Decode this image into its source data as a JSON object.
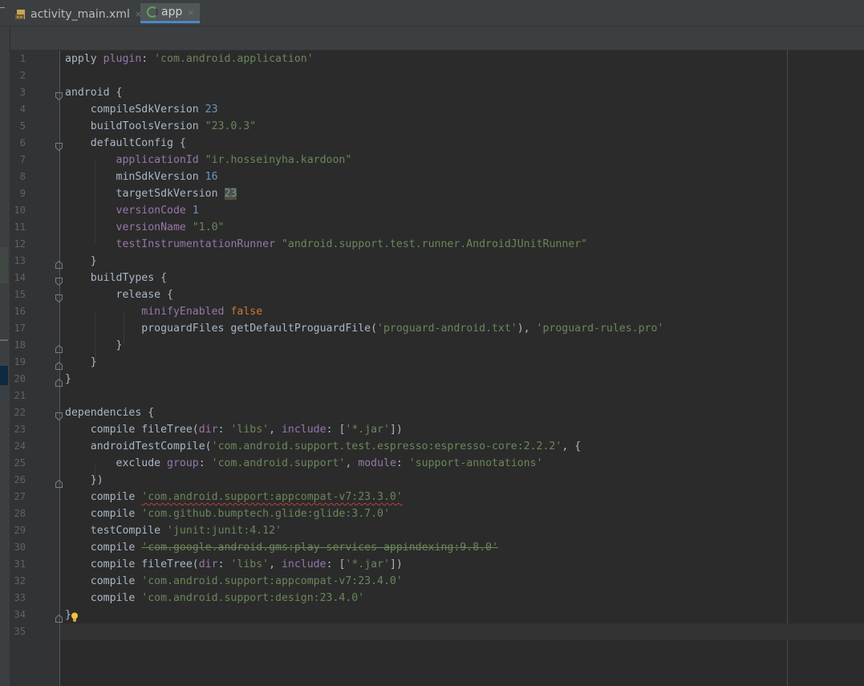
{
  "tabs": [
    {
      "label": "activity_main.xml",
      "icon": "xml-file-icon",
      "close": "×",
      "active": false
    },
    {
      "label": "app",
      "icon": "gradle-app-icon",
      "close": "×",
      "active": true
    }
  ],
  "editor": {
    "lines": [
      {
        "num": "1",
        "tokens": [
          [
            "plain",
            "apply "
          ],
          [
            "p",
            "plugin"
          ],
          [
            "plain",
            ": "
          ],
          [
            "s",
            "'com.android.application'"
          ]
        ]
      },
      {
        "num": "2",
        "tokens": []
      },
      {
        "num": "3",
        "tokens": [
          [
            "plain",
            "android {"
          ]
        ]
      },
      {
        "num": "4",
        "tokens": [
          [
            "plain",
            "    compileSdkVersion "
          ],
          [
            "n",
            "23"
          ]
        ]
      },
      {
        "num": "5",
        "tokens": [
          [
            "plain",
            "    buildToolsVersion "
          ],
          [
            "s",
            "\"23.0.3\""
          ]
        ]
      },
      {
        "num": "6",
        "tokens": [
          [
            "plain",
            "    defaultConfig {"
          ]
        ]
      },
      {
        "num": "7",
        "tokens": [
          [
            "plain",
            "        "
          ],
          [
            "p",
            "applicationId"
          ],
          [
            "plain",
            " "
          ],
          [
            "s",
            "\"ir.hosseinyha.kardoon\""
          ]
        ]
      },
      {
        "num": "8",
        "tokens": [
          [
            "plain",
            "        minSdkVersion "
          ],
          [
            "n",
            "16"
          ]
        ]
      },
      {
        "num": "9",
        "tokens": [
          [
            "plain",
            "        targetSdkVersion "
          ],
          [
            "nh",
            "23"
          ]
        ]
      },
      {
        "num": "10",
        "tokens": [
          [
            "plain",
            "        "
          ],
          [
            "p",
            "versionCode"
          ],
          [
            "plain",
            " "
          ],
          [
            "n",
            "1"
          ]
        ]
      },
      {
        "num": "11",
        "tokens": [
          [
            "plain",
            "        "
          ],
          [
            "p",
            "versionName"
          ],
          [
            "plain",
            " "
          ],
          [
            "s",
            "\"1.0\""
          ]
        ]
      },
      {
        "num": "12",
        "tokens": [
          [
            "plain",
            "        "
          ],
          [
            "p",
            "testInstrumentationRunner"
          ],
          [
            "plain",
            " "
          ],
          [
            "s",
            "\"android.support.test.runner.AndroidJUnitRunner\""
          ]
        ]
      },
      {
        "num": "13",
        "tokens": [
          [
            "plain",
            "    }"
          ]
        ]
      },
      {
        "num": "14",
        "tokens": [
          [
            "plain",
            "    buildTypes {"
          ]
        ]
      },
      {
        "num": "15",
        "tokens": [
          [
            "plain",
            "        release {"
          ]
        ]
      },
      {
        "num": "16",
        "tokens": [
          [
            "plain",
            "            "
          ],
          [
            "p",
            "minifyEnabled"
          ],
          [
            "plain",
            " "
          ],
          [
            "k",
            "false"
          ]
        ]
      },
      {
        "num": "17",
        "tokens": [
          [
            "plain",
            "            proguardFiles getDefaultProguardFile("
          ],
          [
            "s",
            "'proguard-android.txt'"
          ],
          [
            "plain",
            "), "
          ],
          [
            "s",
            "'proguard-rules.pro'"
          ]
        ]
      },
      {
        "num": "18",
        "tokens": [
          [
            "plain",
            "        }"
          ]
        ]
      },
      {
        "num": "19",
        "tokens": [
          [
            "plain",
            "    }"
          ]
        ]
      },
      {
        "num": "20",
        "tokens": [
          [
            "plain",
            "}"
          ]
        ]
      },
      {
        "num": "21",
        "tokens": []
      },
      {
        "num": "22",
        "tokens": [
          [
            "plain",
            "dependencies {"
          ]
        ]
      },
      {
        "num": "23",
        "tokens": [
          [
            "plain",
            "    compile fileTree("
          ],
          [
            "p",
            "dir"
          ],
          [
            "plain",
            ": "
          ],
          [
            "s",
            "'libs'"
          ],
          [
            "plain",
            ", "
          ],
          [
            "p",
            "include"
          ],
          [
            "plain",
            ": ["
          ],
          [
            "s",
            "'*.jar'"
          ],
          [
            "plain",
            "])"
          ]
        ]
      },
      {
        "num": "24",
        "tokens": [
          [
            "plain",
            "    androidTestCompile("
          ],
          [
            "s",
            "'com.android.support.test.espresso:espresso-core:2.2.2'"
          ],
          [
            "plain",
            ", {"
          ]
        ]
      },
      {
        "num": "25",
        "tokens": [
          [
            "plain",
            "        exclude "
          ],
          [
            "p",
            "group"
          ],
          [
            "plain",
            ": "
          ],
          [
            "s",
            "'com.android.support'"
          ],
          [
            "plain",
            ", "
          ],
          [
            "p",
            "module"
          ],
          [
            "plain",
            ": "
          ],
          [
            "s",
            "'support-annotations'"
          ]
        ]
      },
      {
        "num": "26",
        "tokens": [
          [
            "plain",
            "    })"
          ]
        ]
      },
      {
        "num": "27",
        "tokens": [
          [
            "plain",
            "    compile "
          ],
          [
            "ssq",
            "'com.android.support:appcompat-v7:23.3.0'"
          ]
        ]
      },
      {
        "num": "28",
        "tokens": [
          [
            "plain",
            "    compile "
          ],
          [
            "s",
            "'com.github.bumptech.glide:glide:3.7.0'"
          ]
        ]
      },
      {
        "num": "29",
        "tokens": [
          [
            "plain",
            "    testCompile "
          ],
          [
            "s",
            "'junit:junit:4.12'"
          ]
        ]
      },
      {
        "num": "30",
        "tokens": [
          [
            "plain",
            "    compile "
          ],
          [
            "sst",
            "'com.google.android.gms:play-services-appindexing:9.8.0'"
          ]
        ]
      },
      {
        "num": "31",
        "tokens": [
          [
            "plain",
            "    compile fileTree("
          ],
          [
            "p",
            "dir"
          ],
          [
            "plain",
            ": "
          ],
          [
            "s",
            "'libs'"
          ],
          [
            "plain",
            ", "
          ],
          [
            "p",
            "include"
          ],
          [
            "plain",
            ": ["
          ],
          [
            "s",
            "'*.jar'"
          ],
          [
            "plain",
            "])"
          ]
        ]
      },
      {
        "num": "32",
        "tokens": [
          [
            "plain",
            "    compile "
          ],
          [
            "s",
            "'com.android.support:appcompat-v7:23.4.0'"
          ]
        ]
      },
      {
        "num": "33",
        "tokens": [
          [
            "plain",
            "    compile "
          ],
          [
            "s",
            "'com.android.support:design:23.4.0'"
          ]
        ]
      },
      {
        "num": "34",
        "tokens": [
          [
            "plain",
            "}"
          ]
        ]
      },
      {
        "num": "35",
        "tokens": []
      }
    ],
    "fold_lines": [
      3,
      6,
      13,
      14,
      15,
      18,
      19,
      20,
      22,
      26,
      34
    ],
    "fold_closing": [
      13,
      18,
      19,
      20,
      26,
      34
    ],
    "current_line": 35,
    "intention_bulb_line": 34
  }
}
